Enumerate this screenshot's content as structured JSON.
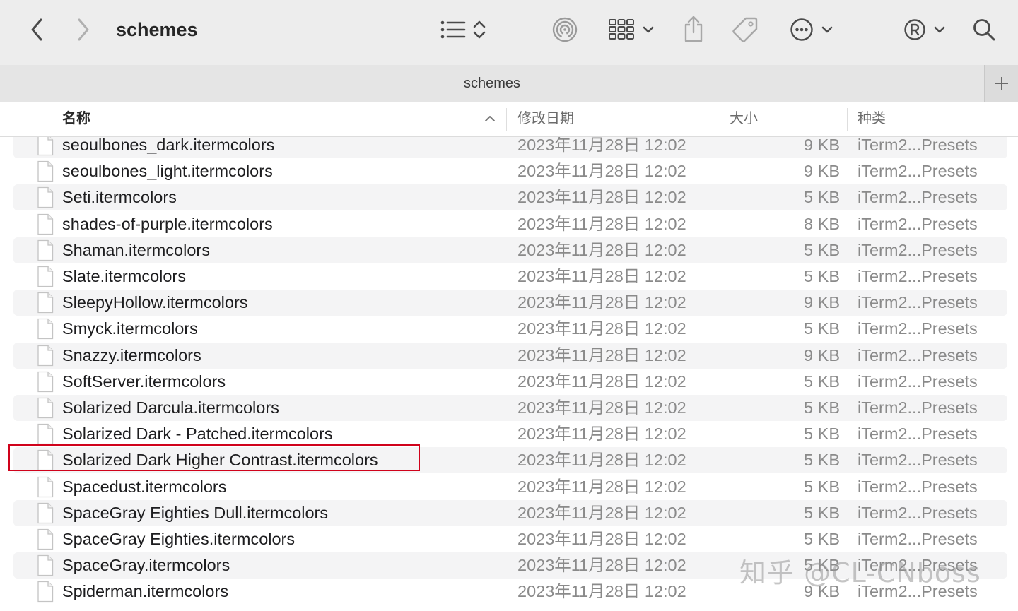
{
  "window": {
    "title": "schemes"
  },
  "tabs": {
    "active_label": "schemes"
  },
  "columns": {
    "name": "名称",
    "date": "修改日期",
    "size": "大小",
    "kind": "种类"
  },
  "toolbar": {
    "icons": [
      "chevron-left-icon",
      "chevron-right-icon",
      "list-view-icon",
      "sort-updown-icon",
      "airdrop-icon",
      "grid-view-icon",
      "chevron-down-icon",
      "share-icon",
      "tag-icon",
      "more-icon",
      "chevron-down-icon",
      "registered-icon",
      "chevron-down-icon",
      "search-icon"
    ]
  },
  "files": [
    {
      "name": "seoulbones_dark.itermcolors",
      "date": "2023年11月28日 12:02",
      "size": "9 KB",
      "kind": "iTerm2...Presets"
    },
    {
      "name": "seoulbones_light.itermcolors",
      "date": "2023年11月28日 12:02",
      "size": "9 KB",
      "kind": "iTerm2...Presets"
    },
    {
      "name": "Seti.itermcolors",
      "date": "2023年11月28日 12:02",
      "size": "5 KB",
      "kind": "iTerm2...Presets"
    },
    {
      "name": "shades-of-purple.itermcolors",
      "date": "2023年11月28日 12:02",
      "size": "8 KB",
      "kind": "iTerm2...Presets"
    },
    {
      "name": "Shaman.itermcolors",
      "date": "2023年11月28日 12:02",
      "size": "5 KB",
      "kind": "iTerm2...Presets"
    },
    {
      "name": "Slate.itermcolors",
      "date": "2023年11月28日 12:02",
      "size": "5 KB",
      "kind": "iTerm2...Presets"
    },
    {
      "name": "SleepyHollow.itermcolors",
      "date": "2023年11月28日 12:02",
      "size": "9 KB",
      "kind": "iTerm2...Presets"
    },
    {
      "name": "Smyck.itermcolors",
      "date": "2023年11月28日 12:02",
      "size": "5 KB",
      "kind": "iTerm2...Presets"
    },
    {
      "name": "Snazzy.itermcolors",
      "date": "2023年11月28日 12:02",
      "size": "9 KB",
      "kind": "iTerm2...Presets"
    },
    {
      "name": "SoftServer.itermcolors",
      "date": "2023年11月28日 12:02",
      "size": "5 KB",
      "kind": "iTerm2...Presets"
    },
    {
      "name": "Solarized Darcula.itermcolors",
      "date": "2023年11月28日 12:02",
      "size": "5 KB",
      "kind": "iTerm2...Presets"
    },
    {
      "name": "Solarized Dark - Patched.itermcolors",
      "date": "2023年11月28日 12:02",
      "size": "5 KB",
      "kind": "iTerm2...Presets"
    },
    {
      "name": "Solarized Dark Higher Contrast.itermcolors",
      "date": "2023年11月28日 12:02",
      "size": "5 KB",
      "kind": "iTerm2...Presets"
    },
    {
      "name": "Spacedust.itermcolors",
      "date": "2023年11月28日 12:02",
      "size": "5 KB",
      "kind": "iTerm2...Presets"
    },
    {
      "name": "SpaceGray Eighties Dull.itermcolors",
      "date": "2023年11月28日 12:02",
      "size": "5 KB",
      "kind": "iTerm2...Presets"
    },
    {
      "name": "SpaceGray Eighties.itermcolors",
      "date": "2023年11月28日 12:02",
      "size": "5 KB",
      "kind": "iTerm2...Presets"
    },
    {
      "name": "SpaceGray.itermcolors",
      "date": "2023年11月28日 12:02",
      "size": "5 KB",
      "kind": "iTerm2...Presets"
    },
    {
      "name": "Spiderman.itermcolors",
      "date": "2023年11月28日 12:02",
      "size": "9 KB",
      "kind": "iTerm2...Presets"
    }
  ],
  "highlighted_file": "Solarized Dark Higher Contrast.itermcolors",
  "colors": {
    "highlight_border": "#d0021b",
    "alt_row": "#f4f4f5",
    "toolbar_bg": "#ededed"
  },
  "watermark": "知乎 @CL-CNboss"
}
